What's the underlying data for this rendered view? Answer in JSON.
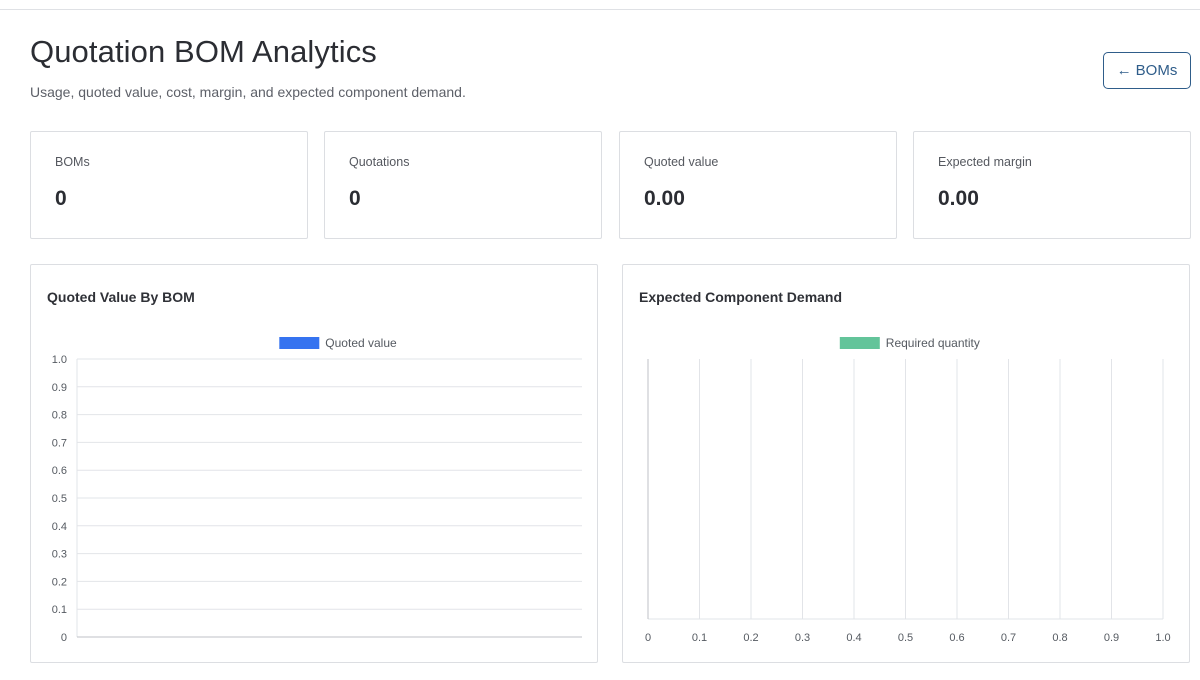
{
  "header": {
    "title": "Quotation BOM Analytics",
    "subtitle": "Usage, quoted value, cost, margin, and expected component demand.",
    "back_button": {
      "arrow": "←",
      "label": "BOMs",
      "icon": "arrow-left-icon"
    }
  },
  "stats": [
    {
      "label": "BOMs",
      "value": "0"
    },
    {
      "label": "Quotations",
      "value": "0"
    },
    {
      "label": "Quoted value",
      "value": "0.00"
    },
    {
      "label": "Expected margin",
      "value": "0.00"
    }
  ],
  "colors": {
    "accent": "#2f5d8a",
    "quoted_value_series": "#3573f0",
    "required_quantity_series": "#63c49a",
    "grid": "#e2e4e8"
  },
  "chart_data": [
    {
      "type": "bar",
      "title": "Quoted Value By BOM",
      "orientation": "vertical",
      "categories": [],
      "series": [
        {
          "name": "Quoted value",
          "values": []
        }
      ],
      "ylim": [
        0,
        1.0
      ],
      "y_ticks": [
        "1.0",
        "0.9",
        "0.8",
        "0.7",
        "0.6",
        "0.5",
        "0.4",
        "0.3",
        "0.2",
        "0.1",
        "0"
      ],
      "grid": true,
      "legend": "top-center"
    },
    {
      "type": "bar",
      "title": "Expected Component Demand",
      "orientation": "horizontal",
      "categories": [],
      "series": [
        {
          "name": "Required quantity",
          "values": []
        }
      ],
      "xlim": [
        0,
        1.0
      ],
      "x_ticks": [
        "0",
        "0.1",
        "0.2",
        "0.3",
        "0.4",
        "0.5",
        "0.6",
        "0.7",
        "0.8",
        "0.9",
        "1.0"
      ],
      "grid": true,
      "legend": "top-center"
    }
  ]
}
